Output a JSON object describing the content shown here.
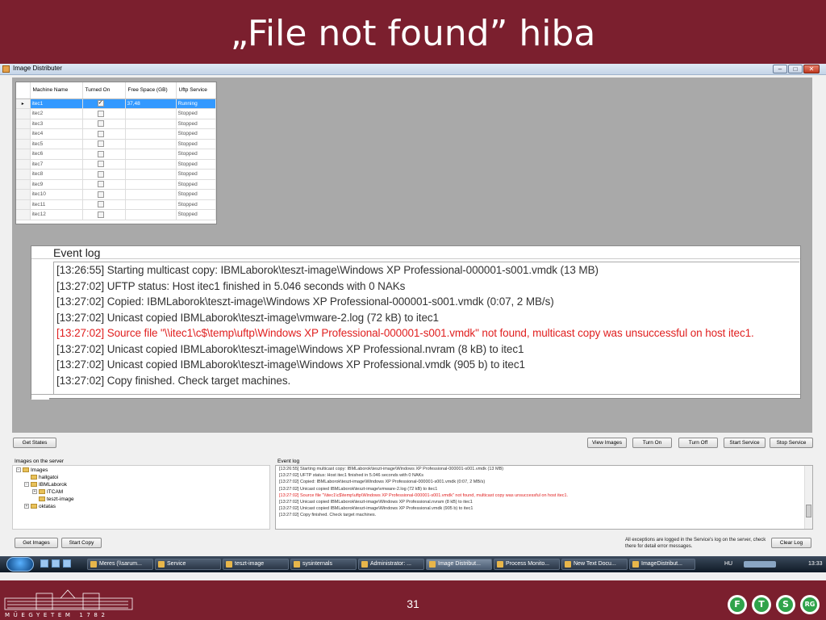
{
  "slide": {
    "title": "„File not found” hiba",
    "page_number": "31",
    "university_text": "MŰEGYETEM 1782",
    "logo_marks": [
      "F",
      "T",
      "S",
      "RG"
    ]
  },
  "window": {
    "title": "Image Distributer",
    "controls": [
      "–",
      "□",
      "✕"
    ]
  },
  "grid": {
    "columns": [
      "Machine Name",
      "Turned On",
      "Free Space (GB)",
      "Uftp Service"
    ],
    "rows": [
      {
        "name": "itec1",
        "on": true,
        "space": "37,48",
        "service": "Running",
        "selected": true
      },
      {
        "name": "itec2",
        "on": false,
        "space": "",
        "service": "Stopped"
      },
      {
        "name": "itec3",
        "on": false,
        "space": "",
        "service": "Stopped"
      },
      {
        "name": "itec4",
        "on": false,
        "space": "",
        "service": "Stopped"
      },
      {
        "name": "itec5",
        "on": false,
        "space": "",
        "service": "Stopped"
      },
      {
        "name": "itec6",
        "on": false,
        "space": "",
        "service": "Stopped"
      },
      {
        "name": "itec7",
        "on": false,
        "space": "",
        "service": "Stopped"
      },
      {
        "name": "itec8",
        "on": false,
        "space": "",
        "service": "Stopped"
      },
      {
        "name": "itec9",
        "on": false,
        "space": "",
        "service": "Stopped"
      },
      {
        "name": "itec10",
        "on": false,
        "space": "",
        "service": "Stopped"
      },
      {
        "name": "itec11",
        "on": false,
        "space": "",
        "service": "Stopped"
      },
      {
        "name": "itec12",
        "on": false,
        "space": "",
        "service": "Stopped"
      }
    ]
  },
  "event_log": {
    "title": "Event log",
    "lines": [
      {
        "text": "[13:26:55] Starting multicast copy: IBMLaborok\\teszt-image\\Windows XP Professional-000001-s001.vmdk (13 MB)",
        "error": false
      },
      {
        "text": "[13:27:02] UFTP status: Host itec1 finished in 5.046 seconds with 0 NAKs",
        "error": false
      },
      {
        "text": "[13:27:02] Copied: IBMLaborok\\teszt-image\\Windows XP Professional-000001-s001.vmdk (0:07, 2 MB/s)",
        "error": false
      },
      {
        "text": "[13:27:02] Unicast copied IBMLaborok\\teszt-image\\vmware-2.log (72 kB) to itec1",
        "error": false
      },
      {
        "text": "[13:27:02] Source file \"\\\\itec1\\c$\\temp\\uftp\\Windows XP Professional-000001-s001.vmdk\" not found, multicast copy was unsuccessful on host itec1.",
        "error": true
      },
      {
        "text": "[13:27:02] Unicast copied IBMLaborok\\teszt-image\\Windows XP Professional.nvram (8 kB) to itec1",
        "error": false
      },
      {
        "text": "[13:27:02] Unicast copied IBMLaborok\\teszt-image\\Windows XP Professional.vmdk (905 b) to itec1",
        "error": false
      },
      {
        "text": "[13:27:02] Copy finished. Check target machines.",
        "error": false
      }
    ]
  },
  "buttons": {
    "get_states": "Get States",
    "view_images": "View Images",
    "turn_on": "Turn On",
    "turn_off": "Turn Off",
    "start_service": "Start Service",
    "stop_service": "Stop Service",
    "get_images": "Get Images",
    "start_copy": "Start Copy",
    "clear_log": "Clear Log"
  },
  "images_panel": {
    "label": "Images on the server",
    "nodes": [
      {
        "label": "Images",
        "depth": 0,
        "toggle": "−"
      },
      {
        "label": "hallgatoi",
        "depth": 1,
        "toggle": ""
      },
      {
        "label": "IBMLaborok",
        "depth": 1,
        "toggle": "−"
      },
      {
        "label": "ITCAM",
        "depth": 2,
        "toggle": "+"
      },
      {
        "label": "teszt-image",
        "depth": 2,
        "toggle": ""
      },
      {
        "label": "oktatas",
        "depth": 1,
        "toggle": "+"
      }
    ]
  },
  "event_panel_label": "Event log",
  "note": "All exceptions are logged in the Service's log on the server, check there for detail error messages.",
  "taskbar": {
    "items": [
      {
        "label": "Meres (\\\\sarum...",
        "active": false
      },
      {
        "label": "Service",
        "active": false
      },
      {
        "label": "teszt-image",
        "active": false
      },
      {
        "label": "sysinternals",
        "active": false
      },
      {
        "label": "Administrator: ...",
        "active": false
      },
      {
        "label": "Image Distribut...",
        "active": true
      },
      {
        "label": "Process Monito...",
        "active": false
      },
      {
        "label": "New Text Docu...",
        "active": false
      },
      {
        "label": "ImageDistribut...",
        "active": false
      }
    ],
    "lang": "HU",
    "clock": "13:33"
  },
  "colors": {
    "slide_background": "#7b1f2e",
    "error_text": "#e02020",
    "selection": "#3399ff",
    "logo_green": "#2fa34a"
  }
}
